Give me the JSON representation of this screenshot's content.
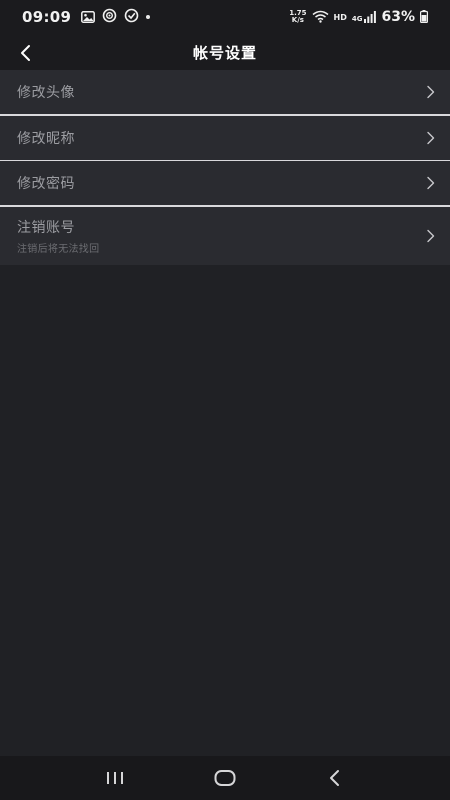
{
  "status_bar": {
    "time": "09:09",
    "net_speed_value": "1.75",
    "net_speed_unit": "K/s",
    "hd_label": "HD",
    "network_label": "4G",
    "battery_percent": "63%",
    "left_icons": [
      "image-icon",
      "sync-icon",
      "sync-alt-icon",
      "notification-dot"
    ],
    "right_icons": [
      "wifi-icon",
      "signal-icon",
      "battery-icon"
    ]
  },
  "header": {
    "title": "帐号设置",
    "back_icon": "chevron-left-icon"
  },
  "settings": {
    "items": [
      {
        "label": "修改头像",
        "icon": "chevron-right-icon"
      },
      {
        "label": "修改昵称",
        "icon": "chevron-right-icon"
      },
      {
        "label": "修改密码",
        "icon": "chevron-right-icon"
      },
      {
        "label": "注销账号",
        "sublabel": "注销后将无法找回",
        "icon": "chevron-right-icon"
      }
    ]
  },
  "nav_bar": {
    "icons": [
      "recent-apps-icon",
      "home-icon",
      "back-icon"
    ]
  },
  "colors": {
    "background": "#202125",
    "row_background": "#2a2b30",
    "header_background": "#1b1b1e",
    "label_text": "#9c9da2",
    "sub_text": "#6c6d72",
    "divider": "#d9d9dc"
  }
}
